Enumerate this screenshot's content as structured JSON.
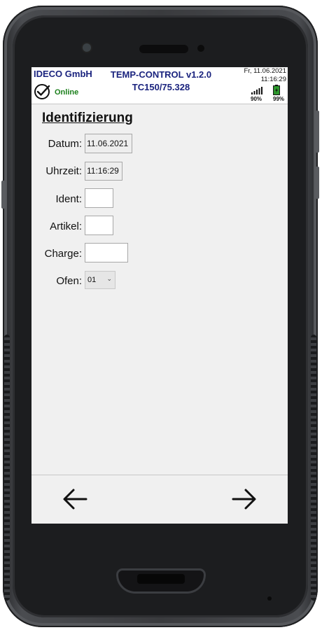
{
  "header": {
    "company": "IDECO GmbH",
    "app_title": "TEMP-CONTROL v1.2.0",
    "device_id": "TC150/75.328",
    "date": "Fr, 11.06.2021",
    "time": "11:16:29",
    "status": "Online",
    "signal_pct": "90%",
    "battery_pct": "99%"
  },
  "form": {
    "title": "Identifizierung",
    "fields": [
      {
        "label": "Datum:",
        "value": "11.06.2021"
      },
      {
        "label": "Uhrzeit:",
        "value": "11:16:29"
      },
      {
        "label": "Ident:",
        "value": ""
      },
      {
        "label": "Artikel:",
        "value": ""
      },
      {
        "label": "Charge:",
        "value": ""
      },
      {
        "label": "Ofen:",
        "value": "01"
      }
    ]
  },
  "footer": {
    "back_icon": "arrow-left-icon",
    "next_icon": "arrow-right-icon"
  },
  "colors": {
    "header_text": "#1a237e",
    "online": "#1b7f1b",
    "battery": "#2e9e2e"
  }
}
